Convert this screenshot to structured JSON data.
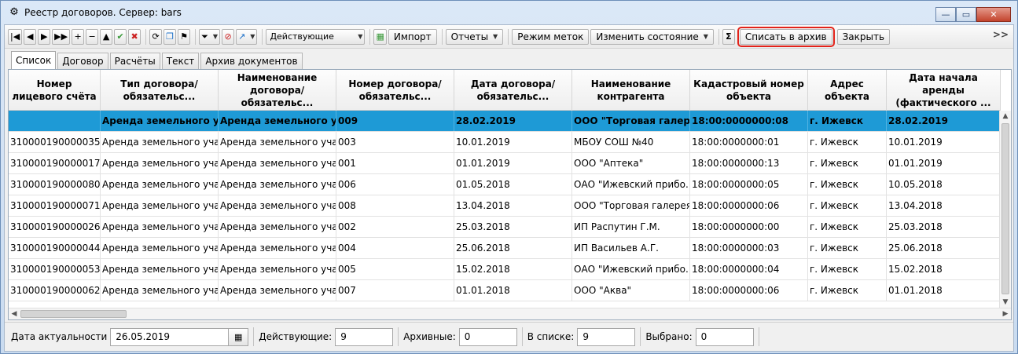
{
  "window": {
    "title": "Реестр договоров. Сервер: bars",
    "app_icon": "gear-icon",
    "controls": {
      "minimize": "—",
      "maximize": "▭",
      "close": "✕"
    }
  },
  "toolbar": {
    "filter_select": "Действующие",
    "import_label": "Импорт",
    "reports_label": "Отчеты",
    "marks_mode_label": "Режим меток",
    "change_state_label": "Изменить состояние",
    "sum_label": "Σ",
    "archive_label": "Списать в архив",
    "close_label": "Закрыть",
    "more_label": ">>",
    "icons": {
      "first": "|◀",
      "prev": "◀",
      "next": "▶",
      "last": "▶▶",
      "add": "+",
      "remove": "−",
      "up": "▲",
      "confirm": "✔",
      "cancel": "✖",
      "refresh": "⟳",
      "copy": "❐",
      "mark": "⚑",
      "filter": "⏷",
      "clear_filter": "⊘",
      "goto": "↗",
      "excel": "▦",
      "dropdown": "▼"
    }
  },
  "tabs": [
    "Список",
    "Договор",
    "Расчёты",
    "Текст",
    "Архив документов"
  ],
  "grid": {
    "columns": [
      "Номер лицевого счёта",
      "Тип договора/обязательс...",
      "Наименование договора/обязательс...",
      "Номер договора/обязательс...",
      "Дата договора/обязательс...",
      "Наименование контрагента",
      "Кадастровый номер объекта",
      "Адрес объекта",
      "Дата начала аренды (фактического ..."
    ],
    "rows": [
      [
        "",
        "Аренда земельного у...",
        "Аренда земельного у...",
        "009",
        "28.02.2019",
        "ООО \"Торговая галер...",
        "18:00:0000000:08",
        "г. Ижевск",
        "28.02.2019"
      ],
      [
        "310000190000035",
        "Аренда земельного уча...",
        "Аренда земельного уча...",
        "003",
        "10.01.2019",
        "МБОУ СОШ №40",
        "18:00:0000000:01",
        "г. Ижевск",
        "10.01.2019"
      ],
      [
        "310000190000017",
        "Аренда земельного уча...",
        "Аренда земельного уча...",
        "001",
        "01.01.2019",
        "ООО \"Аптека\"",
        "18:00:0000000:13",
        "г. Ижевск",
        "01.01.2019"
      ],
      [
        "310000190000080",
        "Аренда земельного уча...",
        "Аренда земельного уча...",
        "006",
        "01.05.2018",
        "ОАО \"Ижевский прибо...",
        "18:00:0000000:05",
        "г. Ижевск",
        "10.05.2018"
      ],
      [
        "310000190000071",
        "Аренда земельного уча...",
        "Аренда земельного уча...",
        "008",
        "13.04.2018",
        "ООО \"Торговая галерея\"",
        "18:00:0000000:06",
        "г. Ижевск",
        "13.04.2018"
      ],
      [
        "310000190000026",
        "Аренда земельного уча...",
        "Аренда земельного уча...",
        "002",
        "25.03.2018",
        "ИП Распутин Г.М.",
        "18:00:0000000:00",
        "г. Ижевск",
        "25.03.2018"
      ],
      [
        "310000190000044",
        "Аренда земельного уча...",
        "Аренда земельного уча...",
        "004",
        "25.06.2018",
        "ИП Васильев А.Г.",
        "18:00:0000000:03",
        "г. Ижевск",
        "25.06.2018"
      ],
      [
        "310000190000053",
        "Аренда земельного уча...",
        "Аренда земельного уча...",
        "005",
        "15.02.2018",
        "ОАО \"Ижевский прибо...",
        "18:00:0000000:04",
        "г. Ижевск",
        "15.02.2018"
      ],
      [
        "310000190000062",
        "Аренда земельного уча...",
        "Аренда земельного уча...",
        "007",
        "01.01.2018",
        "ООО \"Аква\"",
        "18:00:0000000:06",
        "г. Ижевск",
        "01.01.2018"
      ]
    ],
    "selected_row": 0,
    "selection_color": "#1e9ad6"
  },
  "status": {
    "date_label": "Дата актуальности",
    "date_value": "26.05.2019",
    "active_label": "Действующие:",
    "active_value": "9",
    "archived_label": "Архивные:",
    "archived_value": "0",
    "in_list_label": "В списке:",
    "in_list_value": "9",
    "selected_label": "Выбрано:",
    "selected_value": "0",
    "calendar_icon": "▦"
  }
}
